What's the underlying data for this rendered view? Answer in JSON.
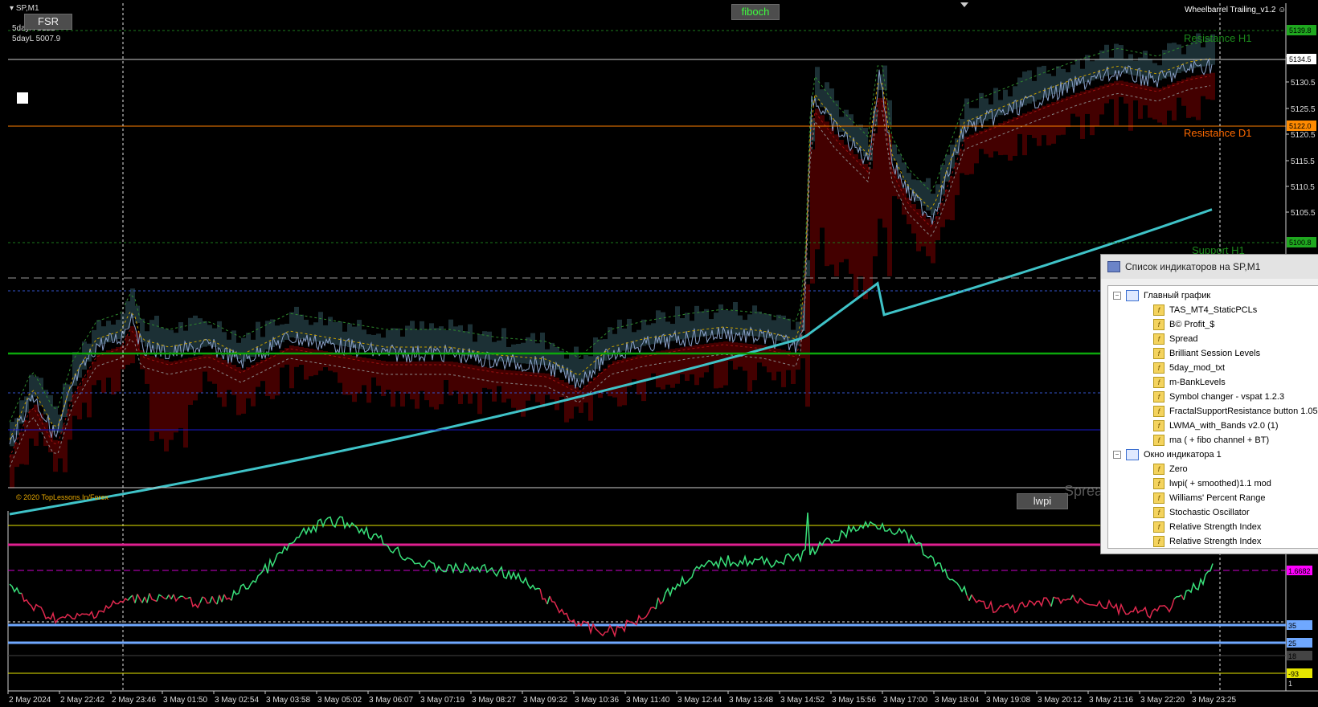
{
  "chart": {
    "symbol_title": "SP,M1",
    "ea_label": "Wheelbarrel Trailing_v1.2",
    "info_lines": [
      "5dayH 5122",
      "5dayL 5007.9"
    ],
    "copyright": "© 2020 TopLessons.In/Forex",
    "spread_label": "Spread",
    "levels": {
      "resistance_h1": "Resistance H1",
      "resistance_d1": "Resistance D1",
      "support_h1": "Support H1"
    },
    "price_axis": [
      "5135.0",
      "5130.5",
      "5125.5",
      "5120.5",
      "5115.5",
      "5110.5",
      "5105.5"
    ],
    "price_tags": [
      {
        "label": "5139.8",
        "color": "#1fa81f"
      },
      {
        "label": "5134.5",
        "color": "#ffffff"
      },
      {
        "label": "5122.0",
        "color": "#ff8a00"
      },
      {
        "label": "5100.8",
        "color": "#1fa81f"
      }
    ],
    "time_axis": [
      "2 May 2024",
      "2 May 22:42",
      "2 May 23:46",
      "3 May 01:50",
      "3 May 02:54",
      "3 May 03:58",
      "3 May 05:02",
      "3 May 06:07",
      "3 May 07:19",
      "3 May 08:27",
      "3 May 09:32",
      "3 May 10:36",
      "3 May 11:40",
      "3 May 12:44",
      "3 May 13:48",
      "3 May 14:52",
      "3 May 15:56",
      "3 May 17:00",
      "3 May 18:04",
      "3 May 19:08",
      "3 May 20:12",
      "3 May 21:16",
      "3 May 22:20",
      "3 May 23:25"
    ]
  },
  "buttons": {
    "fsr": "FSR",
    "fiboch": "fiboch",
    "lwpi": "lwpi"
  },
  "indicator_window": {
    "tags": [
      {
        "label": "1.6682",
        "color": "#ff00ff"
      },
      {
        "label": "35",
        "color": "#6fa8ff"
      },
      {
        "label": "25",
        "color": "#6fa8ff"
      },
      {
        "label": "18",
        "color": "#444444"
      },
      {
        "label": "-93",
        "color": "#e6e600"
      },
      {
        "label": "1",
        "color": "#000000"
      }
    ]
  },
  "indicator_list": {
    "title": "Список индикаторов на SP,M1",
    "main_chart_label": "Главный график",
    "main_items": [
      "TAS_MT4_StaticPCLs",
      "B© Profit_$",
      "Spread",
      "Brilliant Session Levels",
      "5day_mod_txt",
      "m-BankLevels",
      "Symbol changer - vspat 1.2.3",
      "FractalSupportResistance button 1.05",
      "LWMA_with_Bands v2.0 (1)",
      "ma ( + fibo channel + BT)"
    ],
    "window1_label": "Окно индикатора 1",
    "window1_items": [
      "Zero",
      "lwpi( + smoothed)1.1 mod",
      "Williams' Percent Range",
      "Stochastic Oscillator",
      "Relative Strength Index",
      "Relative Strength Index"
    ]
  },
  "colors": {
    "bull_band": "#1e3338",
    "bear_band": "#4a0000",
    "ma_line": "#3fc3c8",
    "osc_up": "#39e07a",
    "osc_down": "#e0284e"
  }
}
